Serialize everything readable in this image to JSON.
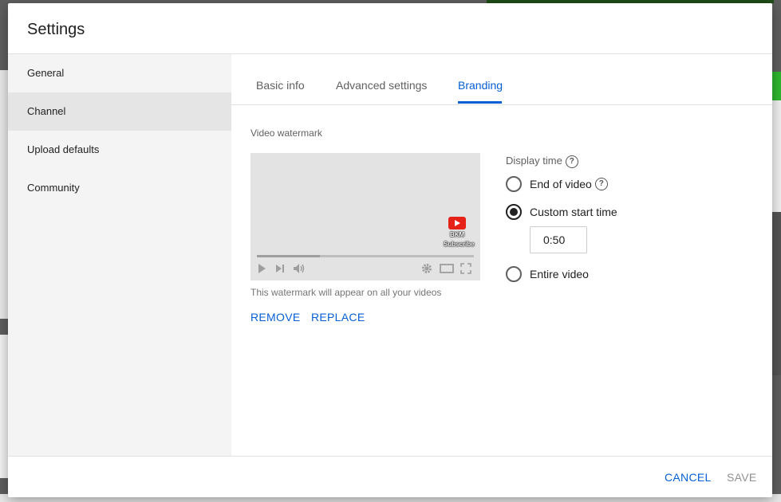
{
  "dialog": {
    "title": "Settings"
  },
  "sidebar": {
    "items": [
      {
        "label": "General"
      },
      {
        "label": "Channel",
        "active": true
      },
      {
        "label": "Upload defaults"
      },
      {
        "label": "Community"
      }
    ]
  },
  "tabs": [
    {
      "label": "Basic info"
    },
    {
      "label": "Advanced settings"
    },
    {
      "label": "Branding",
      "active": true
    }
  ],
  "watermark": {
    "section_label": "Video watermark",
    "logo_text_line1": "BKM",
    "logo_text_line2": "Subscribe",
    "progress_percent": 29,
    "caption": "This watermark will appear on all your videos",
    "remove_label": "REMOVE",
    "replace_label": "REPLACE"
  },
  "display_time": {
    "label": "Display time",
    "options": [
      {
        "label": "End of video",
        "checked": false
      },
      {
        "label": "Custom start time",
        "checked": true
      },
      {
        "label": "Entire video",
        "checked": false
      }
    ],
    "custom_start_value": "0:50"
  },
  "footer": {
    "cancel_label": "CANCEL",
    "save_label": "SAVE"
  },
  "colors": {
    "accent": "#065fd4",
    "disabled": "#909090",
    "sidebar_bg": "#f4f4f4",
    "sidebar_active": "#e5e5e5"
  },
  "icons": [
    "help-icon",
    "play-icon",
    "next-icon",
    "volume-icon",
    "gear-icon",
    "theater-icon",
    "fullscreen-icon",
    "youtube-logo-icon"
  ]
}
